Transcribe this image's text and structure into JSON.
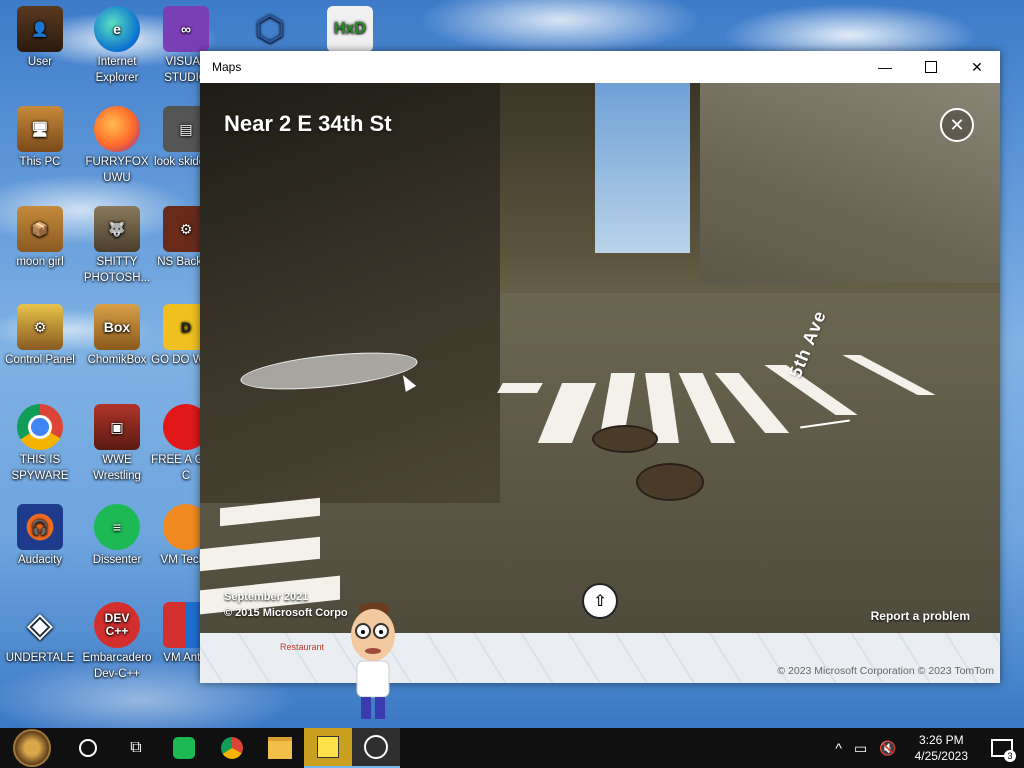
{
  "desktop": {
    "icons": [
      {
        "label": "User"
      },
      {
        "label": "Internet Explorer"
      },
      {
        "label": "VISUAL STUDIO"
      },
      {
        "label": "This PC"
      },
      {
        "label": "FURRYFOX UWU"
      },
      {
        "label": "look skidded"
      },
      {
        "label": "moon girl"
      },
      {
        "label": "SHITTY PHOTOSH..."
      },
      {
        "label": "NS Backup"
      },
      {
        "label": "Control Panel"
      },
      {
        "label": "ChomikBox"
      },
      {
        "label": "GO DO WHO"
      },
      {
        "label": "THIS IS SPYWARE"
      },
      {
        "label": "WWE Wrestling"
      },
      {
        "label": "FREE A GIFT C"
      },
      {
        "label": "Audacity"
      },
      {
        "label": "Dissenter"
      },
      {
        "label": "VM Techn"
      },
      {
        "label": "UNDERTALE"
      },
      {
        "label": "Embarcadero Dev-C++"
      },
      {
        "label": "VM Antiv"
      }
    ]
  },
  "window": {
    "title": "Maps",
    "minimize_icon": "minimize-icon",
    "maximize_icon": "maximize-icon",
    "close_icon": "close-icon"
  },
  "streetside": {
    "location_title": "Near 2 E 34th St",
    "street_label": "5th Ave",
    "capture_date": "September 2021",
    "copyright": "© 2015 Microsoft Corpo",
    "report_link": "Report a problem",
    "close_icon": "close-circle-icon"
  },
  "map": {
    "place_label": "Restaurant",
    "copyright": "© 2023 Microsoft Corporation © 2023 TomTom"
  },
  "taskbar": {
    "time": "3:26 PM",
    "date": "4/25/2023",
    "notification_count": "3",
    "pinned": [
      "start-button",
      "cortana-search",
      "task-view",
      "dissenter",
      "chrome",
      "file-explorer",
      "sticky-notes",
      "maps"
    ]
  },
  "colors": {
    "taskbar": "#101010",
    "taskbar_active_underline": "#76b9ed",
    "titlebar": "#ffffff"
  }
}
